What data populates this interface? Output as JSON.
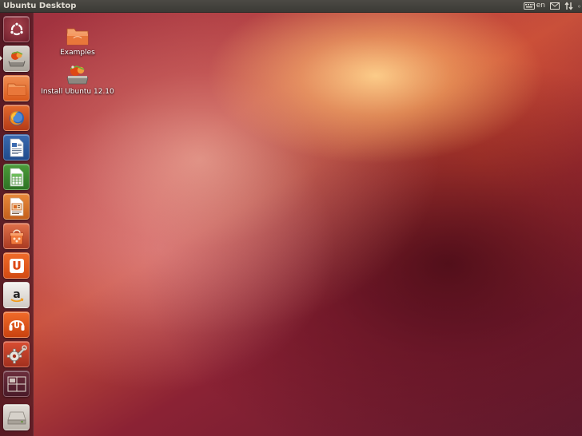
{
  "top_panel": {
    "title": "Ubuntu Desktop",
    "indicators": [
      {
        "icon": "keyboard-icon",
        "label": "en"
      },
      {
        "icon": "envelope-icon"
      },
      {
        "icon": "network-arrows-icon"
      }
    ]
  },
  "launcher": {
    "items": [
      {
        "name": "dash-home",
        "icon": "ubuntu-logo-icon"
      },
      {
        "name": "install-ubuntu",
        "icon": "installer-icon"
      },
      {
        "name": "home-folder",
        "icon": "folder-icon"
      },
      {
        "name": "firefox",
        "icon": "firefox-icon"
      },
      {
        "name": "libreoffice-writer",
        "icon": "writer-document-icon"
      },
      {
        "name": "libreoffice-calc",
        "icon": "calc-spreadsheet-icon"
      },
      {
        "name": "libreoffice-impress",
        "icon": "impress-presentation-icon"
      },
      {
        "name": "software-center",
        "icon": "shopping-bag-icon"
      },
      {
        "name": "ubuntu-one",
        "icon": "ubuntu-one-icon"
      },
      {
        "name": "amazon",
        "icon": "amazon-icon"
      },
      {
        "name": "ubuntu-one-music",
        "icon": "ubuntu-one-music-icon"
      },
      {
        "name": "system-settings",
        "icon": "settings-icon"
      },
      {
        "name": "workspace-switcher",
        "icon": "workspaces-icon"
      },
      {
        "name": "devices",
        "icon": "drive-icon"
      }
    ]
  },
  "desktop": {
    "icons": [
      {
        "label": "Examples",
        "icon": "folder-icon"
      },
      {
        "label": "Install Ubuntu 12.10",
        "icon": "installer-icon"
      }
    ]
  },
  "colors": {
    "panel": "#3b3a36",
    "ubuntu_orange": "#dd4814",
    "aubergine": "#5e1a2e",
    "launcher_bg": "#4a1822"
  }
}
